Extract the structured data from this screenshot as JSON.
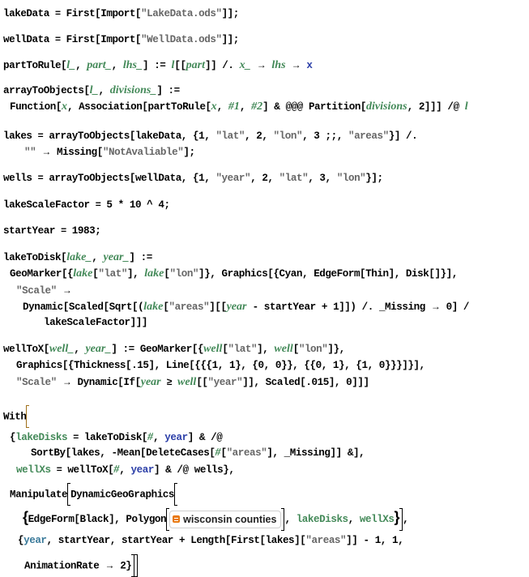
{
  "notebook": {
    "cells": [
      {
        "id": "lakeData",
        "tokens": [
          "lakeData",
          " = ",
          "First",
          "[",
          "Import",
          "[",
          "\"LakeData.ods\"",
          "]];"
        ]
      },
      {
        "id": "wellData",
        "tokens": [
          "wellData",
          " = ",
          "First",
          "[",
          "Import",
          "[",
          "\"WellData.ods\"",
          "]];"
        ]
      },
      {
        "id": "partToRule",
        "text": "partToRule[l_, part_, lhs_] := l[[part]] /. x_ → lhs → x"
      },
      {
        "id": "arrayToObjects",
        "text": "arrayToObjects[l_, divisions_] := Function[x, Association[partToRule[x, #1, #2] & @@@ Partition[divisions, 2]]] /@ l"
      },
      {
        "id": "lakes",
        "text": "lakes = arrayToObjects[lakeData, {1, \"lat\", 2, \"lon\", 3 ;;, \"areas\"}] /. \"\" → Missing[\"NotAvaliable\"];"
      },
      {
        "id": "wells",
        "text": "wells = arrayToObjects[wellData, {1, \"year\", 2, \"lat\", 3, \"lon\"}];"
      },
      {
        "id": "lakeScaleFactor",
        "text": "lakeScaleFactor = 5 * 10 ^ 4;"
      },
      {
        "id": "startYear",
        "text": "startYear = 1983;"
      },
      {
        "id": "lakeToDisk",
        "text": "lakeToDisk[lake_, year_] := GeoMarker[{lake[\"lat\"], lake[\"lon\"]}, Graphics[{Cyan, EdgeForm[Thin], Disk[]}], \"Scale\" → Dynamic[Scaled[Sqrt[(lake[\"areas\"][[year - startYear + 1]]) /. _Missing → 0] / lakeScaleFactor]]]"
      },
      {
        "id": "wellToX",
        "text": "wellToX[well_, year_] := GeoMarker[{well[\"lat\"], well[\"lon\"]}, Graphics[{Thickness[.15], Line[{{{1, 1}, {0, 0}}, {{0, 1}, {1, 0}}}]}], \"Scale\" → Dynamic[If[year ≥ well[[\"year\"]], Scaled[.015], 0]]]"
      },
      {
        "id": "with",
        "text": "With[{lakeDisks = lakeToDisk[#, year] & /@ SortBy[lakes, -Mean[DeleteCases[#[\"areas\"], _Missing]] &], wellXs = wellToX[#, year] & /@ wells}, Manipulate[DynamicGeoGraphics[{EdgeForm[Black], Polygon[wisconsin counties], lakeDisks, wellXs}], {year, startYear, startYear + Length[First[lakes][\"areas\"]] - 1, 1, AnimationRate → 2}]]"
      }
    ],
    "strings": {
      "lakeFile": "\"LakeData.ods\"",
      "wellFile": "\"WellData.ods\"",
      "lat": "\"lat\"",
      "lon": "\"lon\"",
      "areas": "\"areas\"",
      "year": "\"year\"",
      "empty": "\"\"",
      "notAvailable": "\"NotAvaliable\"",
      "scale": "\"Scale\""
    },
    "entity": {
      "label": "wisconsin counties",
      "icon": "entity-icon"
    },
    "values": {
      "lakeScaleFactor": "5 * 10 ^ 4",
      "startYear": "1983",
      "thickness": ".15",
      "scaled": ".015",
      "animationRate": "2"
    }
  }
}
